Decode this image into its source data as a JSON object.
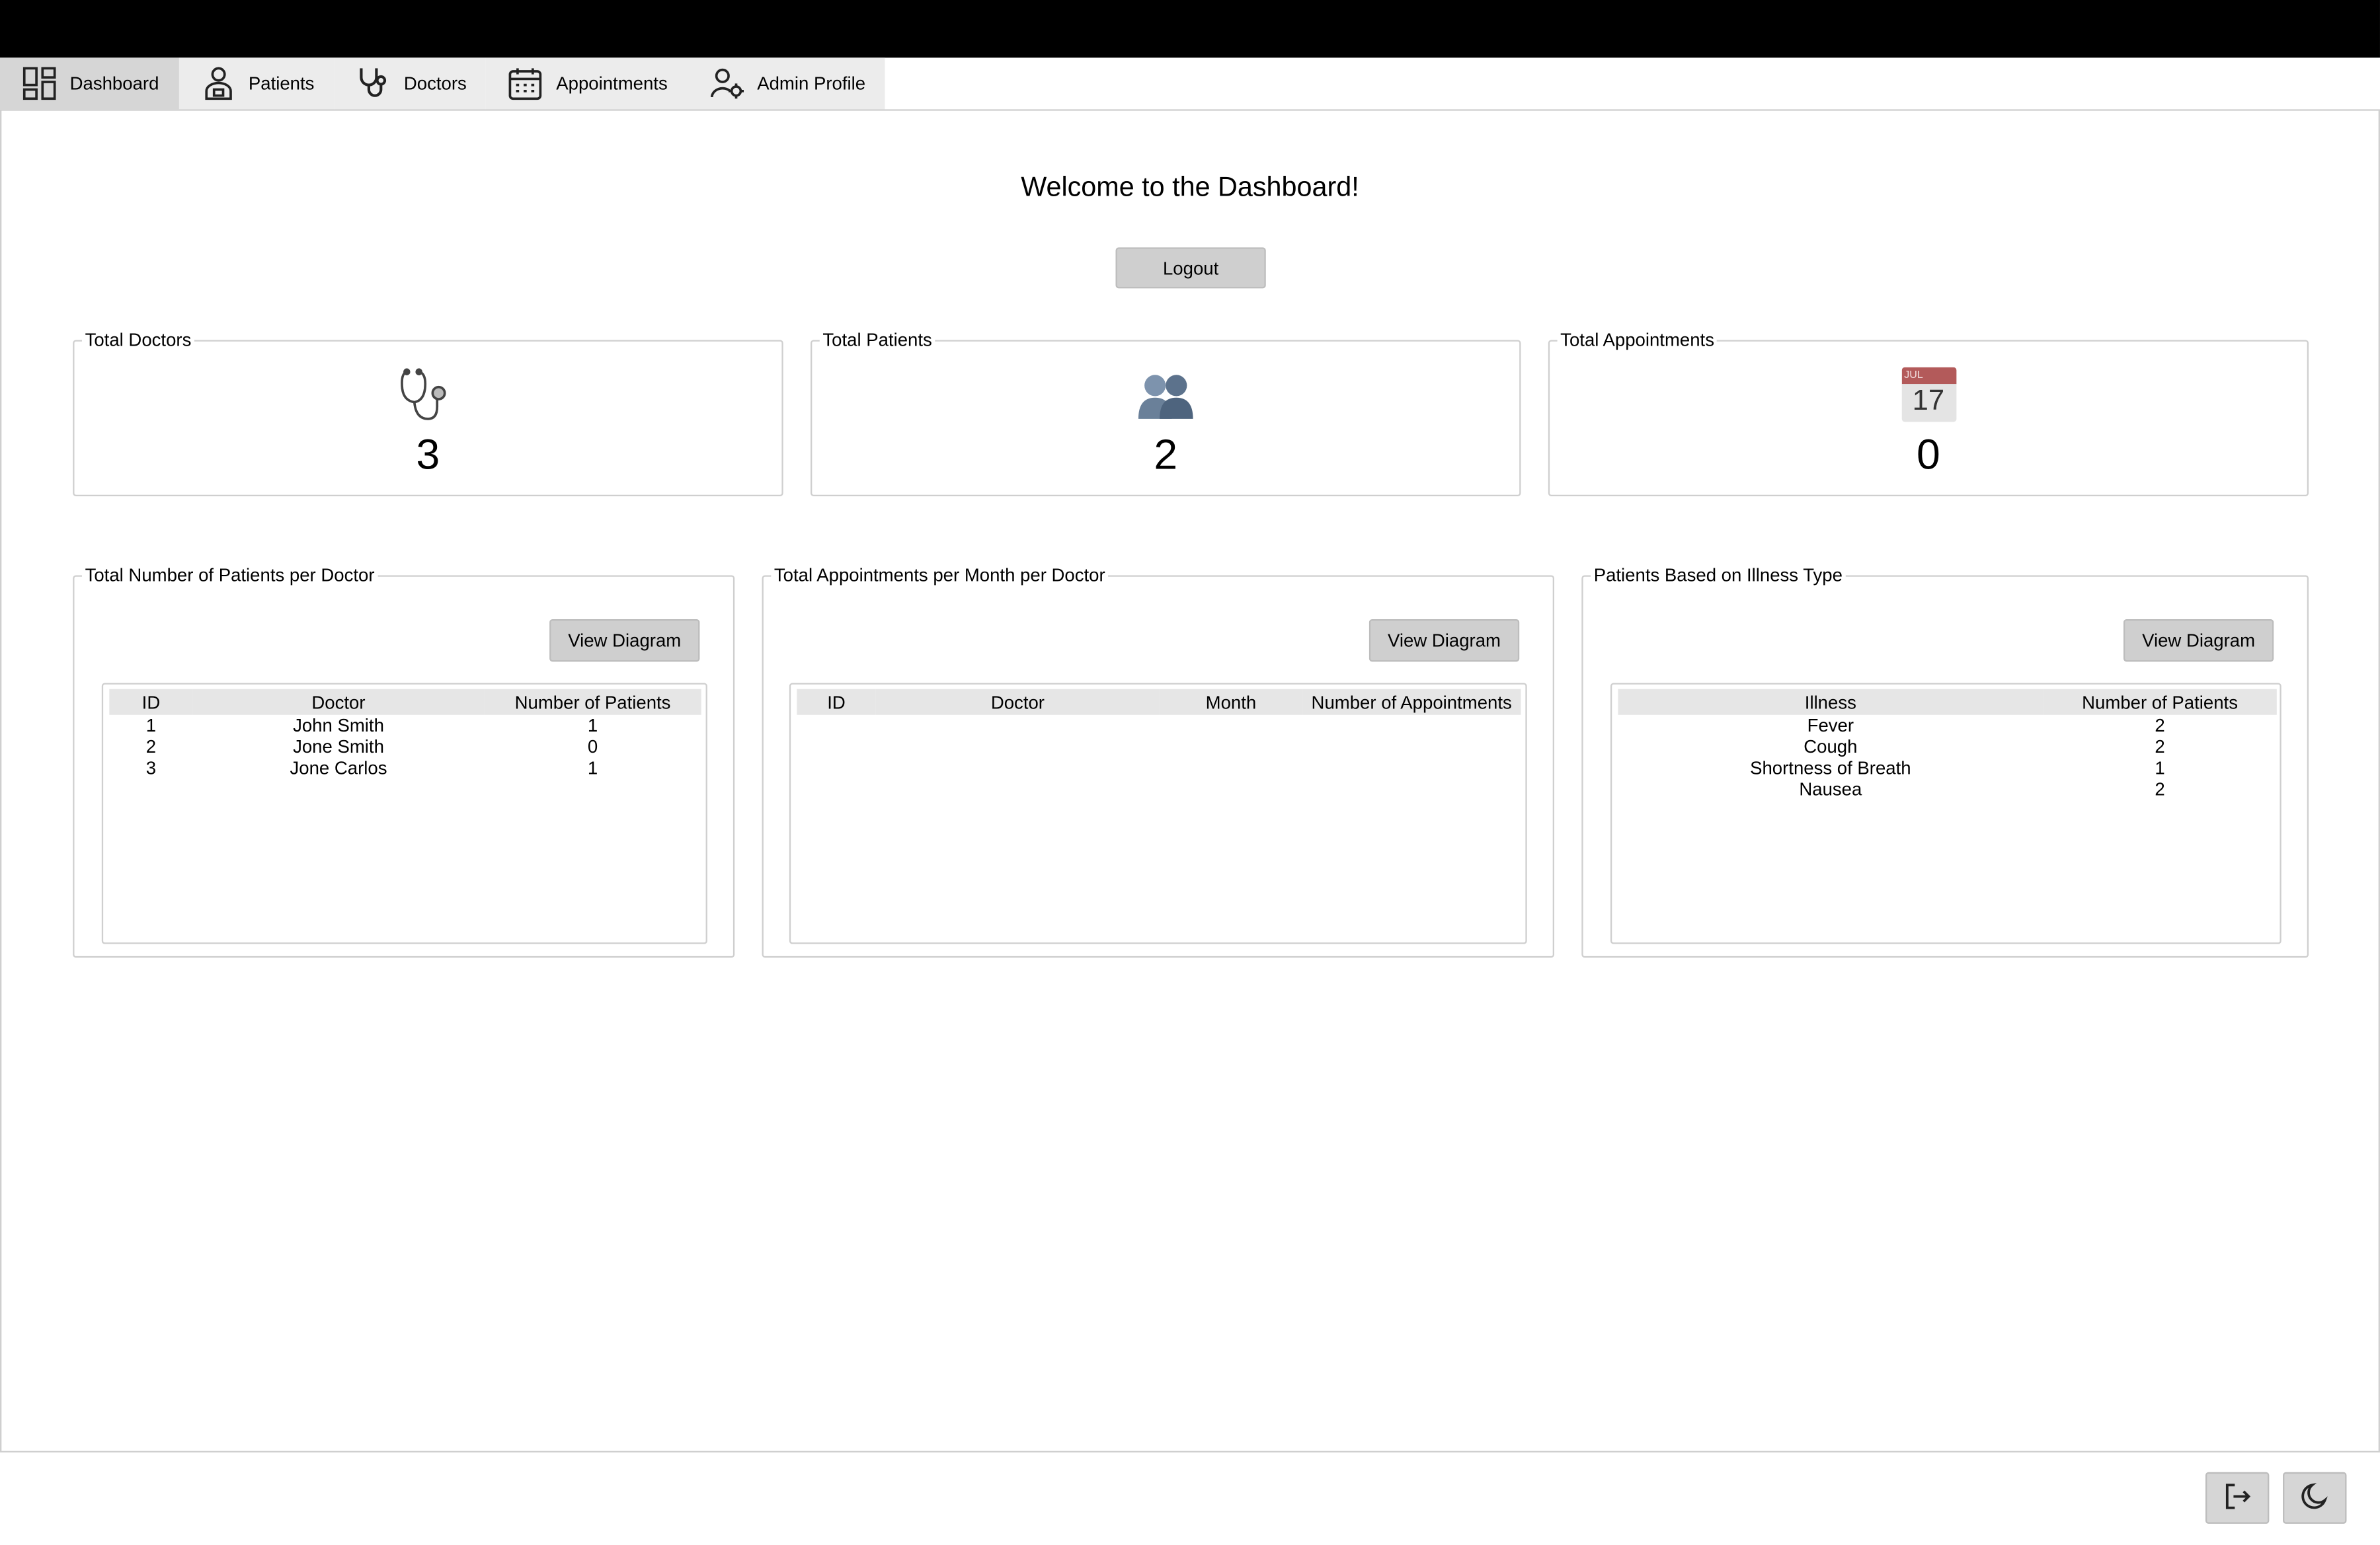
{
  "tabs": [
    {
      "label": "Dashboard",
      "icon": "dashboard-icon",
      "active": true
    },
    {
      "label": "Patients",
      "icon": "patient-icon",
      "active": false
    },
    {
      "label": "Doctors",
      "icon": "stethoscope-icon",
      "active": false
    },
    {
      "label": "Appointments",
      "icon": "calendar-icon",
      "active": false
    },
    {
      "label": "Admin Profile",
      "icon": "user-gear-icon",
      "active": false
    }
  ],
  "main": {
    "welcome": "Welcome to the Dashboard!",
    "logout_label": "Logout"
  },
  "stats": {
    "doctors": {
      "title": "Total Doctors",
      "value": "3",
      "icon": "stethoscope-emoji-icon"
    },
    "patients": {
      "title": "Total Patients",
      "value": "2",
      "icon": "people-emoji-icon"
    },
    "appointments": {
      "title": "Total Appointments",
      "value": "0",
      "icon": "calendar-emoji-icon",
      "icon_month": "JUL",
      "icon_day": "17"
    }
  },
  "panels": {
    "patients_per_doctor": {
      "title": "Total Number of Patients per Doctor",
      "button": "View Diagram",
      "columns": [
        "ID",
        "Doctor",
        "Number of Patients"
      ],
      "rows": [
        [
          "1",
          "John Smith",
          "1"
        ],
        [
          "2",
          "Jone Smith",
          "0"
        ],
        [
          "3",
          "Jone Carlos",
          "1"
        ]
      ]
    },
    "appointments_per_month": {
      "title": "Total Appointments per Month per Doctor",
      "button": "View Diagram",
      "columns": [
        "ID",
        "Doctor",
        "Month",
        "Number of Appointments"
      ],
      "rows": []
    },
    "illness": {
      "title": "Patients Based on Illness Type",
      "button": "View Diagram",
      "columns": [
        "Illness",
        "Number of Patients"
      ],
      "rows": [
        [
          "Fever",
          "2"
        ],
        [
          "Cough",
          "2"
        ],
        [
          "Shortness of Breath",
          "1"
        ],
        [
          "Nausea",
          "2"
        ]
      ]
    }
  },
  "footer": {
    "exit_icon": "sign-out-icon",
    "theme_icon": "moon-icon"
  },
  "colors": {
    "topbar": "#000000",
    "tab_active": "#d6d6d6",
    "tab_bg": "#ececec",
    "button": "#cfcfcf",
    "header_row": "#e6e6e6"
  }
}
